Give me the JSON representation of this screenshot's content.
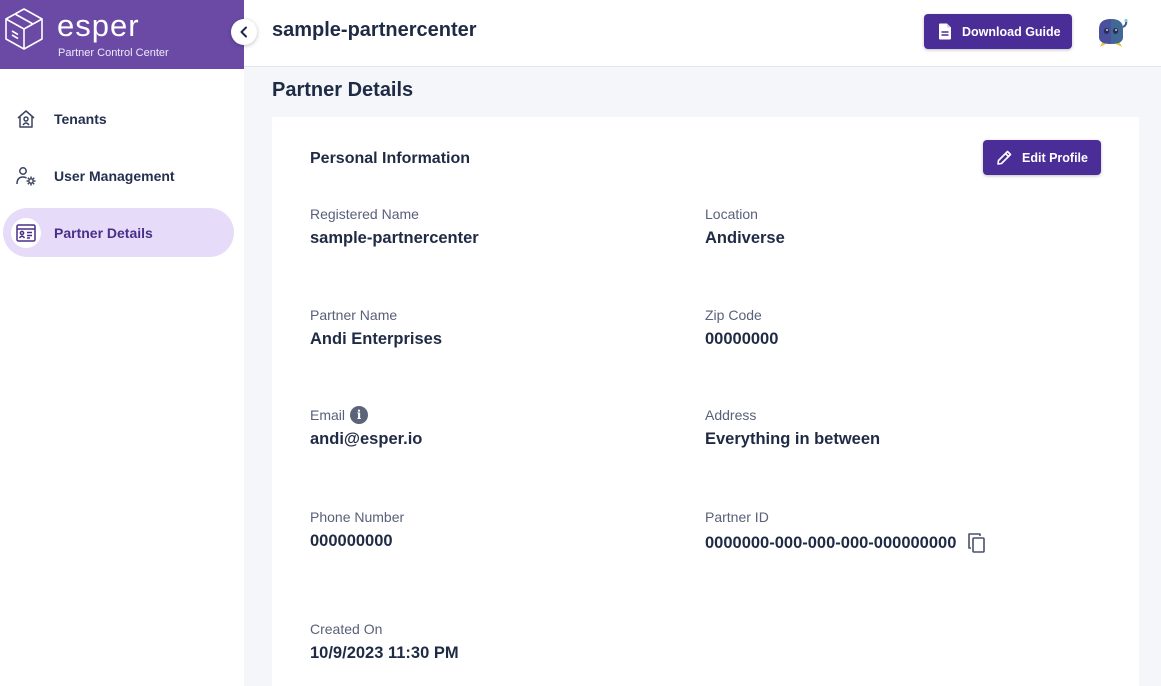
{
  "brand": {
    "name": "esper",
    "subtitle": "Partner Control Center",
    "color": "#6b4aa6"
  },
  "sidebar": {
    "items": [
      {
        "label": "Tenants",
        "icon": "home-icon",
        "active": false
      },
      {
        "label": "User Management",
        "icon": "user-gear-icon",
        "active": false
      },
      {
        "label": "Partner Details",
        "icon": "id-card-icon",
        "active": true
      }
    ]
  },
  "header": {
    "title": "sample-partnercenter",
    "download_label": "Download Guide",
    "accent": "#4b2d97"
  },
  "main": {
    "page_title": "Partner Details",
    "card_title": "Personal Information",
    "edit_label": "Edit Profile",
    "fields": {
      "registered_name": {
        "label": "Registered Name",
        "value": "sample-partnercenter"
      },
      "location": {
        "label": "Location",
        "value": "Andiverse"
      },
      "partner_name": {
        "label": "Partner Name",
        "value": "Andi Enterprises"
      },
      "zip_code": {
        "label": "Zip Code",
        "value": "00000000"
      },
      "email": {
        "label": "Email",
        "value": "andi@esper.io"
      },
      "address": {
        "label": "Address",
        "value": "Everything in between"
      },
      "phone": {
        "label": "Phone Number",
        "value": "000000000"
      },
      "partner_id": {
        "label": "Partner ID",
        "value": "0000000-000-000-000-000000000"
      },
      "created_on": {
        "label": "Created On",
        "value": "10/9/2023 11:30 PM"
      }
    }
  }
}
